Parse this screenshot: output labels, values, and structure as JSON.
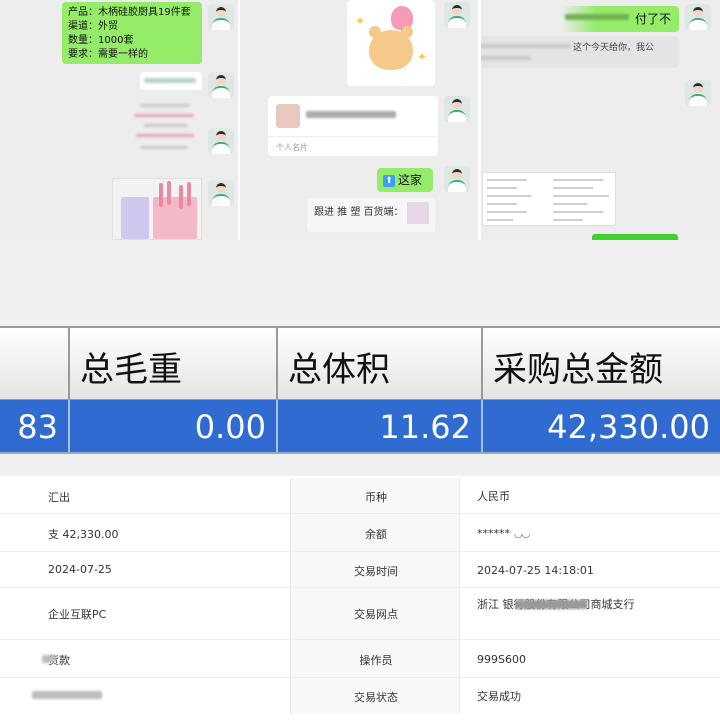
{
  "chat1": {
    "order_lines": [
      "产品：木柄硅胶厨具19件套",
      "渠道：外贸",
      "数量：1000套",
      "要求：需要一样的"
    ]
  },
  "chat2": {
    "card_label": "个人名片",
    "location_reply": "这家",
    "location_icon": "up-arrow-icon",
    "follow_text": "跟进 推 塑 百货端："
  },
  "chat3": {
    "paid_text": "付了不",
    "reply_fragment": "这个今天给你，我公"
  },
  "spreadsheet": {
    "headers": [
      "",
      "总毛重",
      "总体积",
      "采购总金额"
    ],
    "values": [
      "83",
      "0.00",
      "11.62",
      "42,330.00"
    ]
  },
  "transaction": {
    "rows": [
      {
        "left": "汇出",
        "label": "币种",
        "value": "人民币"
      },
      {
        "left": "支 42,330.00",
        "label": "余额",
        "value": "******"
      },
      {
        "left": "2024-07-25",
        "label": "交易时间",
        "value": "2024-07-25 14:18:01"
      },
      {
        "left": "企业互联PC",
        "label": "交易网点",
        "value": "浙江            银行股份有限公司商城支行"
      },
      {
        "left": "货款",
        "label": "操作员",
        "value": "999S600"
      },
      {
        "left": "",
        "label": "交易状态",
        "value": "交易成功"
      }
    ],
    "balance_icon": "eye-closed-icon"
  }
}
